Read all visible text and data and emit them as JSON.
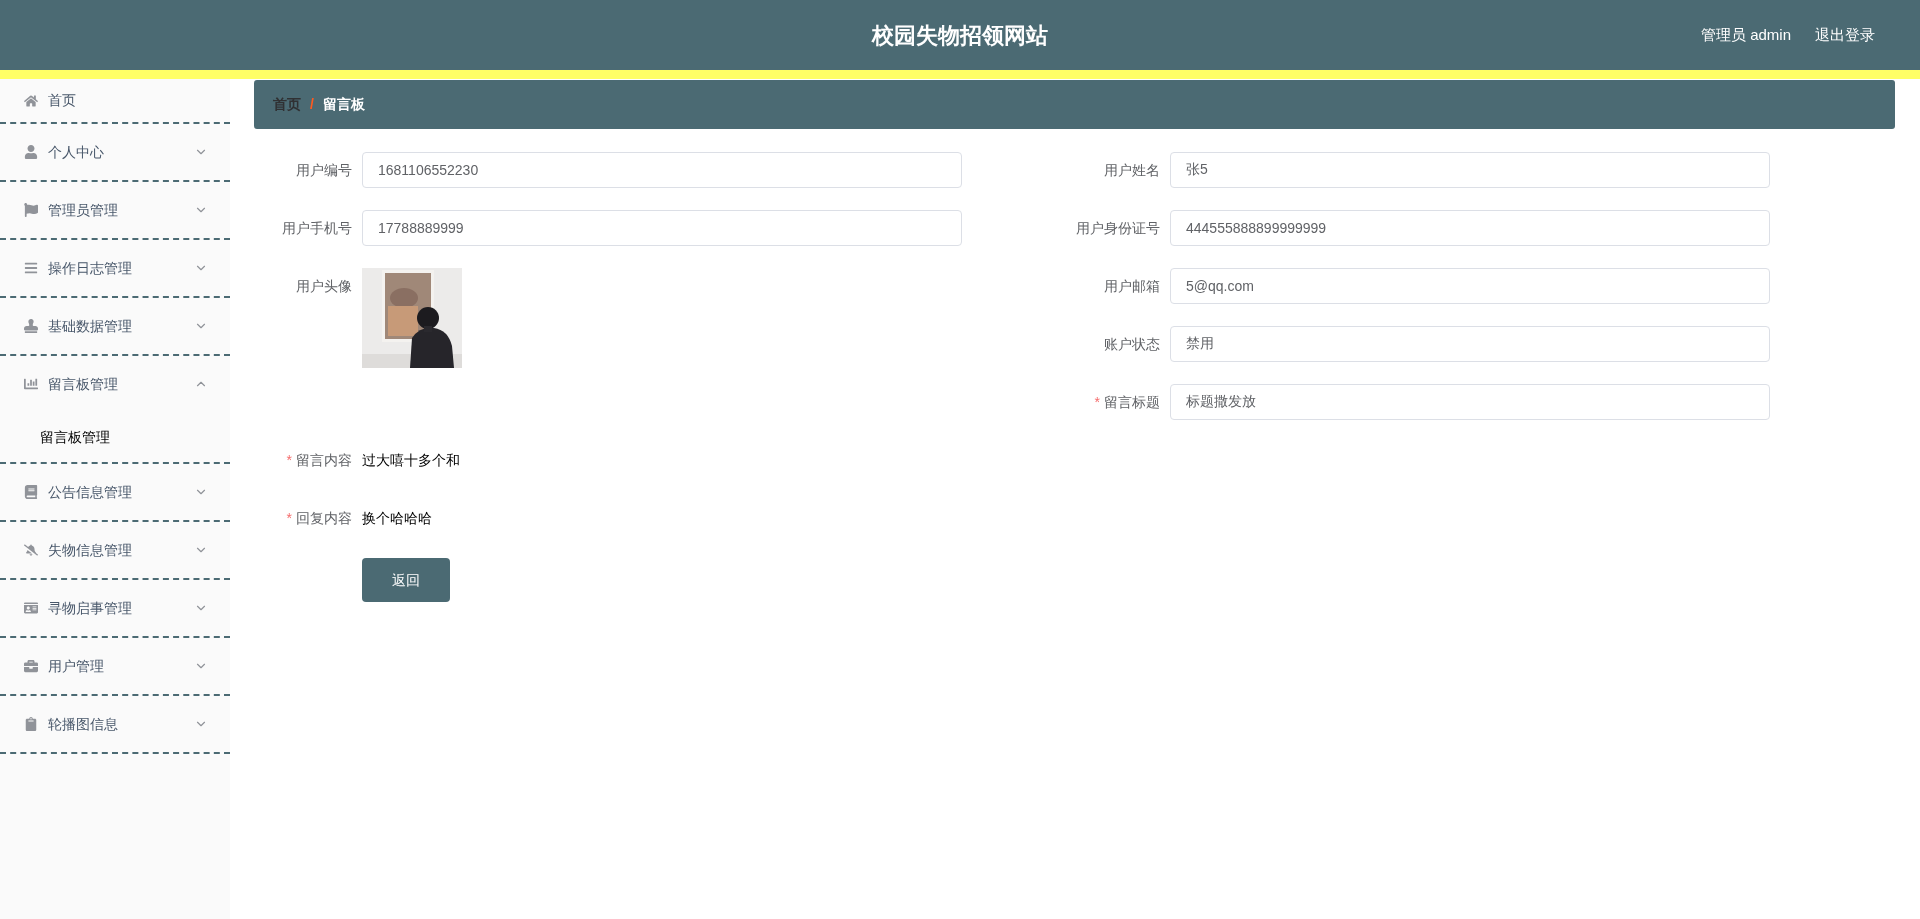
{
  "header": {
    "title": "校园失物招领网站",
    "user": "管理员 admin",
    "logout": "退出登录"
  },
  "sidebar": {
    "items": [
      {
        "label": "首页"
      },
      {
        "label": "个人中心",
        "expanded": false
      },
      {
        "label": "管理员管理",
        "expanded": false
      },
      {
        "label": "操作日志管理",
        "expanded": false
      },
      {
        "label": "基础数据管理",
        "expanded": false
      },
      {
        "label": "留言板管理",
        "expanded": true,
        "children": [
          {
            "label": "留言板管理"
          }
        ]
      },
      {
        "label": "公告信息管理",
        "expanded": false
      },
      {
        "label": "失物信息管理",
        "expanded": false
      },
      {
        "label": "寻物启事管理",
        "expanded": false
      },
      {
        "label": "用户管理",
        "expanded": false
      },
      {
        "label": "轮播图信息",
        "expanded": false
      }
    ]
  },
  "breadcrumb": {
    "separator": "/",
    "items": [
      {
        "label": "首页",
        "selected": false
      },
      {
        "label": "留言板",
        "selected": true
      }
    ]
  },
  "form": {
    "left": [
      {
        "label": "用户编号",
        "kind": "input",
        "value": "1681106552230"
      },
      {
        "label": "用户手机号",
        "kind": "input",
        "value": "17788889999"
      },
      {
        "label": "用户头像",
        "kind": "picture"
      }
    ],
    "right": [
      {
        "label": "用户姓名",
        "kind": "input",
        "value": "张5"
      },
      {
        "label": "用户身份证号",
        "kind": "input",
        "value": "444555888899999999"
      },
      {
        "label": "用户邮箱",
        "kind": "input",
        "value": "5@qq.com"
      },
      {
        "label": "账户状态",
        "kind": "input",
        "value": "禁用"
      },
      {
        "label": "留言标题",
        "kind": "input",
        "value": "标题撒发放",
        "required_mark": "*"
      }
    ],
    "bottom": [
      {
        "label": "留言内容",
        "kind": "text",
        "value": "过大嘻十多个和",
        "required_mark": "*"
      },
      {
        "label": "回复内容",
        "kind": "text",
        "value": "换个哈哈哈",
        "required_mark": "*"
      }
    ],
    "button": "返回"
  }
}
